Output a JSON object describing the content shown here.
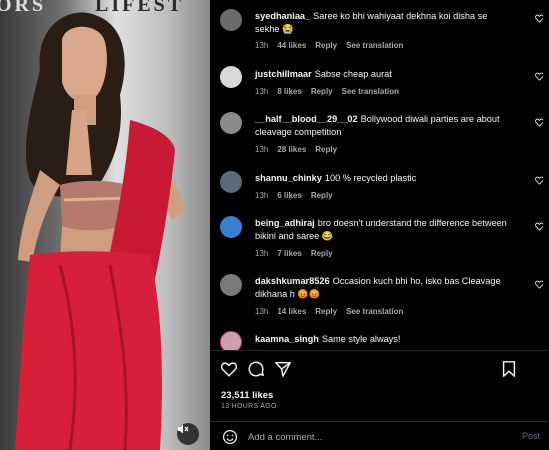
{
  "media": {
    "backdrop_left": "ORS",
    "backdrop_right": "LIFEST",
    "mute_icon": "speaker-muted-icon"
  },
  "comments": [
    {
      "user": "syedhaniaa_",
      "text": "Saree ko bhi wahiyaat dekhna koi disha se sekhe 😭",
      "time": "13h",
      "likes": "44 likes",
      "reply": "Reply",
      "translate": "See translation",
      "avatar_color": "#6b6b6b"
    },
    {
      "user": "justchillmaar",
      "text": "Sabse cheap aurat",
      "time": "13h",
      "likes": "8 likes",
      "reply": "Reply",
      "translate": "See translation",
      "avatar_color": "#d9d9d9"
    },
    {
      "user": "__half__blood__29__02",
      "text": "Bollywood diwali parties are about cleavage competition",
      "time": "13h",
      "likes": "28 likes",
      "reply": "Reply",
      "translate": "",
      "avatar_color": "#8a8a8a"
    },
    {
      "user": "shannu_chinky",
      "text": "100 % recycled plastic",
      "time": "13h",
      "likes": "6 likes",
      "reply": "Reply",
      "translate": "",
      "avatar_color": "#5a6a7a"
    },
    {
      "user": "being_adhiraj",
      "text": "bro doesn't understand the difference between bikini and saree 😂",
      "time": "13h",
      "likes": "7 likes",
      "reply": "Reply",
      "translate": "",
      "avatar_color": "#3a7fd0"
    },
    {
      "user": "dakshkumar8526",
      "text": "Occasion kuch bhi ho, isko bas Cleavage dikhana h 😡😡",
      "time": "13h",
      "likes": "14 likes",
      "reply": "Reply",
      "translate": "See translation",
      "avatar_color": "#7a7a7a"
    },
    {
      "user": "kaamna_singh",
      "text": "Same style always!",
      "time": "",
      "likes": "",
      "reply": "",
      "translate": "",
      "avatar_color": "#c9a0b0"
    }
  ],
  "actions": {
    "like_icon": "heart-icon",
    "comment_icon": "comment-icon",
    "share_icon": "share-icon",
    "save_icon": "bookmark-icon",
    "likes_count": "23,511 likes",
    "posted_ago": "13 HOURS AGO"
  },
  "composer": {
    "emoji_icon": "emoji-icon",
    "placeholder": "Add a comment...",
    "post_label": "Post"
  },
  "colors": {
    "background": "#000000",
    "text_primary": "#f5f5f5",
    "text_secondary": "#a8a8a8",
    "post_disabled": "#4f6f8f",
    "saree_red": "#d81f3a"
  }
}
